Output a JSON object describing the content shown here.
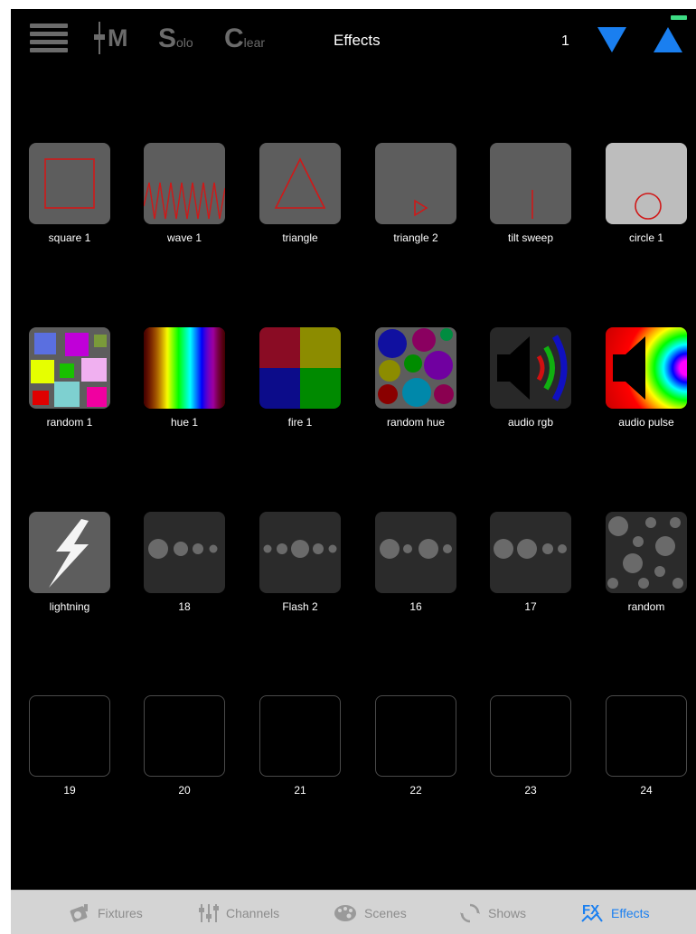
{
  "header": {
    "menu_icon": "hamburger-menu-icon",
    "master_label": "M",
    "solo_big": "S",
    "solo_small": "olo",
    "clear_big": "C",
    "clear_small": "lear",
    "title": "Effects",
    "page_number": "1",
    "down_arrow_icon": "triangle-down-icon",
    "up_arrow_icon": "triangle-up-icon",
    "accent_color": "#1a7ff0",
    "battery_color": "#3ddc84"
  },
  "effects": [
    {
      "label": "square 1",
      "icon": "square-icon"
    },
    {
      "label": "wave 1",
      "icon": "zigzag-wave-icon"
    },
    {
      "label": "triangle",
      "icon": "triangle-icon"
    },
    {
      "label": "triangle 2",
      "icon": "small-triangle-icon"
    },
    {
      "label": "tilt sweep",
      "icon": "vertical-line-icon"
    },
    {
      "label": "circle 1",
      "icon": "circle-icon"
    },
    {
      "label": "random 1",
      "icon": "random-color-squares-icon"
    },
    {
      "label": "hue 1",
      "icon": "hue-rainbow-icon"
    },
    {
      "label": "fire 1",
      "icon": "four-color-quadrant-icon"
    },
    {
      "label": "random hue",
      "icon": "random-hue-circles-icon"
    },
    {
      "label": "audio rgb",
      "icon": "speaker-rgb-icon"
    },
    {
      "label": "audio pulse",
      "icon": "speaker-pulse-icon"
    },
    {
      "label": "lightning",
      "icon": "lightning-bolt-icon"
    },
    {
      "label": "18",
      "icon": "dots-icon"
    },
    {
      "label": "Flash 2",
      "icon": "dots-icon"
    },
    {
      "label": "16",
      "icon": "dots-icon"
    },
    {
      "label": "17",
      "icon": "dots-icon"
    },
    {
      "label": "random",
      "icon": "random-dots-icon"
    },
    {
      "label": "19",
      "icon": "empty-slot"
    },
    {
      "label": "20",
      "icon": "empty-slot"
    },
    {
      "label": "21",
      "icon": "empty-slot"
    },
    {
      "label": "22",
      "icon": "empty-slot"
    },
    {
      "label": "23",
      "icon": "empty-slot"
    },
    {
      "label": "24",
      "icon": "empty-slot"
    }
  ],
  "tabs": [
    {
      "label": "Fixtures",
      "icon": "fixture-light-icon",
      "active": false
    },
    {
      "label": "Channels",
      "icon": "sliders-icon",
      "active": false
    },
    {
      "label": "Scenes",
      "icon": "palette-icon",
      "active": false
    },
    {
      "label": "Shows",
      "icon": "circular-arrows-icon",
      "active": false
    },
    {
      "label": "Effects",
      "icon": "fx-icon",
      "active": true
    }
  ],
  "colors": {
    "shape_red": "#d01818",
    "tile_grey": "#5d5d5d",
    "tab_inactive": "#8c8c8c",
    "tab_active": "#1a7ff0"
  }
}
